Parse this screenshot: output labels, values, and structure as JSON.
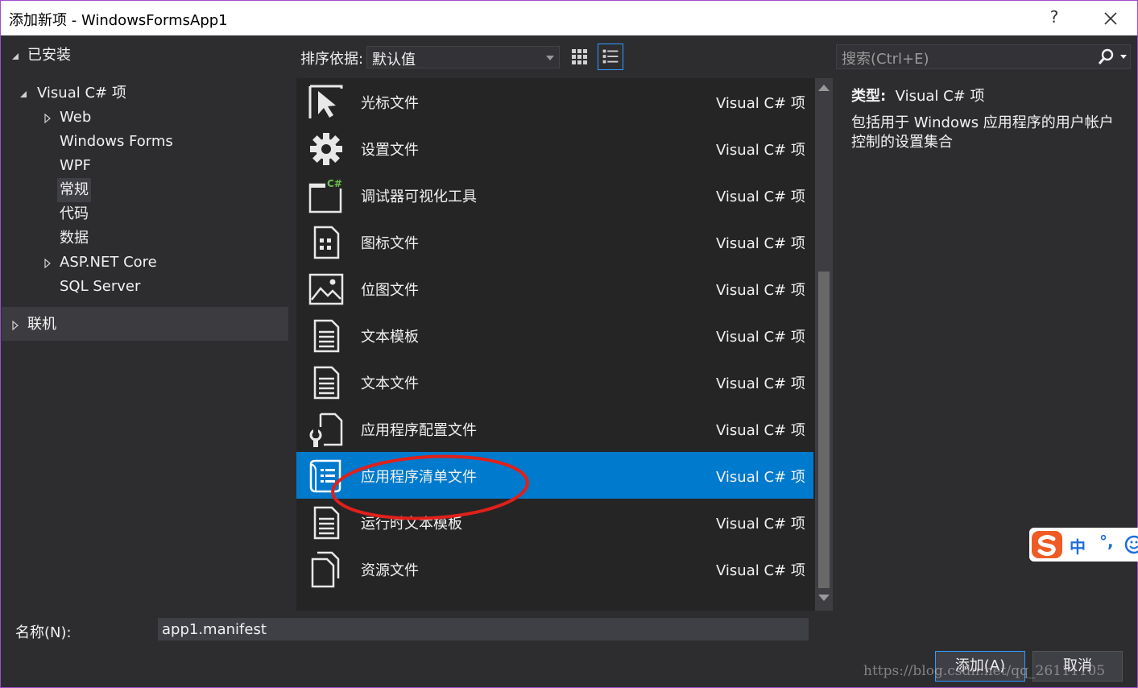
{
  "window": {
    "title": "添加新项 - WindowsFormsApp1",
    "help_label": "?",
    "close_icon": "close-icon"
  },
  "tree": {
    "installed": "已安装",
    "visual_csharp": "Visual C# 项",
    "children": [
      "Web",
      "Windows Forms",
      "WPF",
      "常规",
      "代码",
      "数据",
      "ASP.NET Core",
      "SQL Server"
    ],
    "online": "联机"
  },
  "toolbar": {
    "sort_label": "排序依据:",
    "sort_value": "默认值"
  },
  "search": {
    "placeholder": "搜索(Ctrl+E)"
  },
  "items": [
    {
      "name": "光标文件",
      "type": "Visual C# 项",
      "icon": "cursor-file-icon"
    },
    {
      "name": "设置文件",
      "type": "Visual C# 项",
      "icon": "gear-icon"
    },
    {
      "name": "调试器可视化工具",
      "type": "Visual C# 项",
      "icon": "debugger-visualizer-icon"
    },
    {
      "name": "图标文件",
      "type": "Visual C# 项",
      "icon": "icon-file-icon"
    },
    {
      "name": "位图文件",
      "type": "Visual C# 项",
      "icon": "bitmap-icon"
    },
    {
      "name": "文本模板",
      "type": "Visual C# 项",
      "icon": "text-template-icon"
    },
    {
      "name": "文本文件",
      "type": "Visual C# 项",
      "icon": "text-file-icon"
    },
    {
      "name": "应用程序配置文件",
      "type": "Visual C# 项",
      "icon": "config-file-icon"
    },
    {
      "name": "应用程序清单文件",
      "type": "Visual C# 项",
      "icon": "manifest-file-icon"
    },
    {
      "name": "运行时文本模板",
      "type": "Visual C# 项",
      "icon": "runtime-text-template-icon"
    },
    {
      "name": "资源文件",
      "type": "Visual C# 项",
      "icon": "resource-file-icon"
    }
  ],
  "description": {
    "type_key": "类型:",
    "type_value": "Visual C# 项",
    "text": "包括用于 Windows 应用程序的用户帐户控制的设置集合"
  },
  "ime": {
    "label": "中",
    "punct": "°,"
  },
  "name_field": {
    "label": "名称(N):",
    "value": "app1.manifest"
  },
  "buttons": {
    "add": "添加(A)",
    "cancel": "取消"
  },
  "watermark": "https://blog.csdn.net/qq_26111105",
  "colors": {
    "selection": "#007acc",
    "annotation": "#e0201a",
    "background": "#2d2d30"
  }
}
